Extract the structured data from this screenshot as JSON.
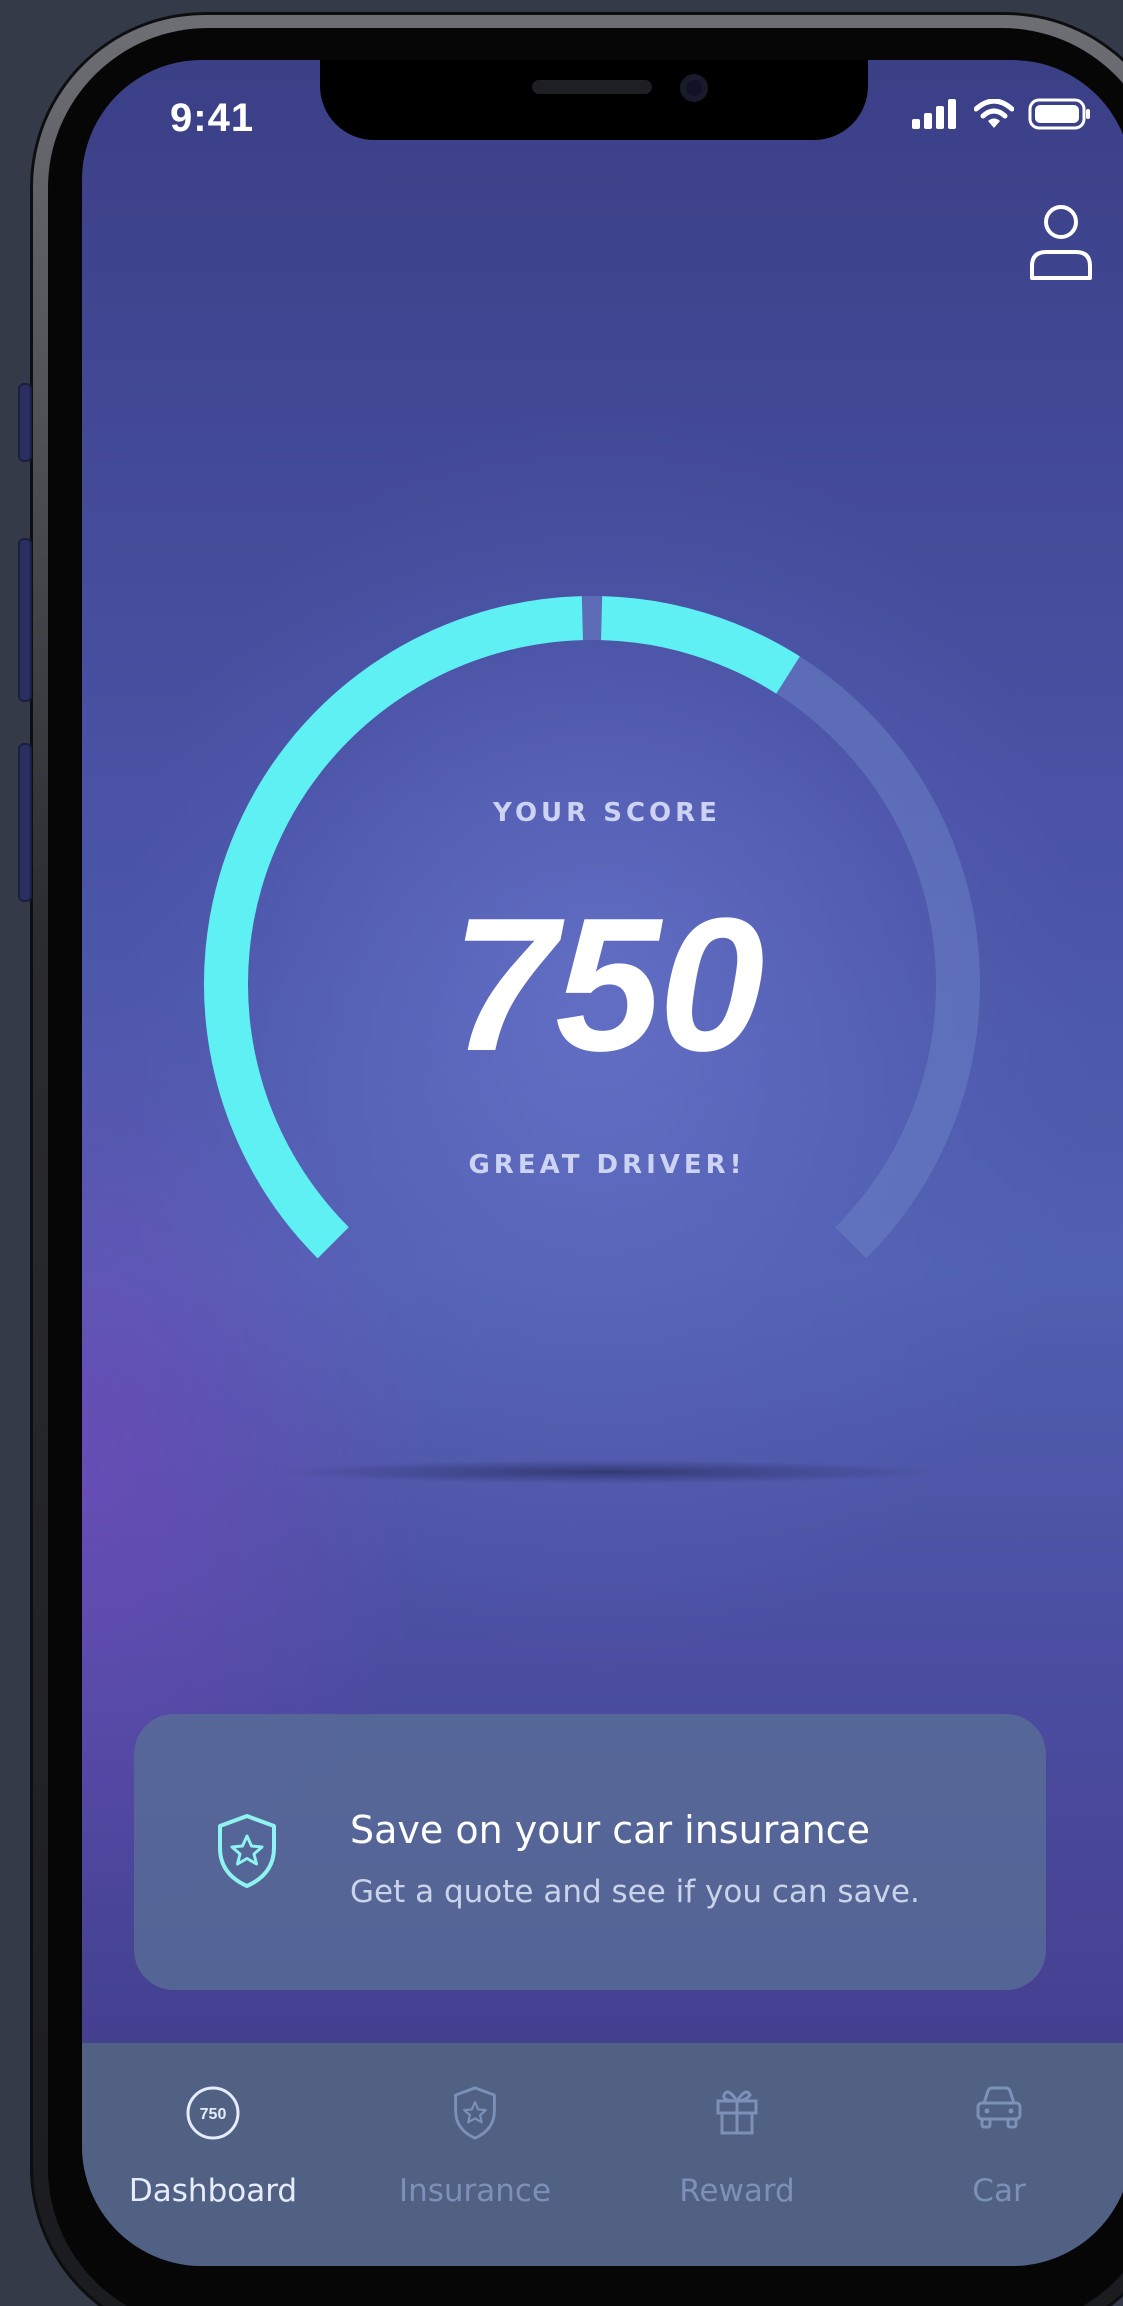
{
  "status_bar": {
    "time": "9:41"
  },
  "score": {
    "label": "YOUR SCORE",
    "value": "750",
    "status": "GREAT DRIVER!",
    "fill_fraction": 0.62
  },
  "promo_card": {
    "icon": "shield-star-icon",
    "title": "Save on your car insurance",
    "subtitle": "Get a quote and see if you can save."
  },
  "tabs": [
    {
      "label": "Dashboard",
      "icon": "score-badge-icon",
      "badge": "750",
      "active": true
    },
    {
      "label": "Insurance",
      "icon": "shield-star-icon",
      "active": false
    },
    {
      "label": "Reward",
      "icon": "gift-icon",
      "active": false
    },
    {
      "label": "Car",
      "icon": "car-icon",
      "active": false
    }
  ],
  "colors": {
    "gauge_fill": "#5ff0f4",
    "gauge_track": "#6a80c4",
    "card_icon": "#8ff3f0"
  }
}
